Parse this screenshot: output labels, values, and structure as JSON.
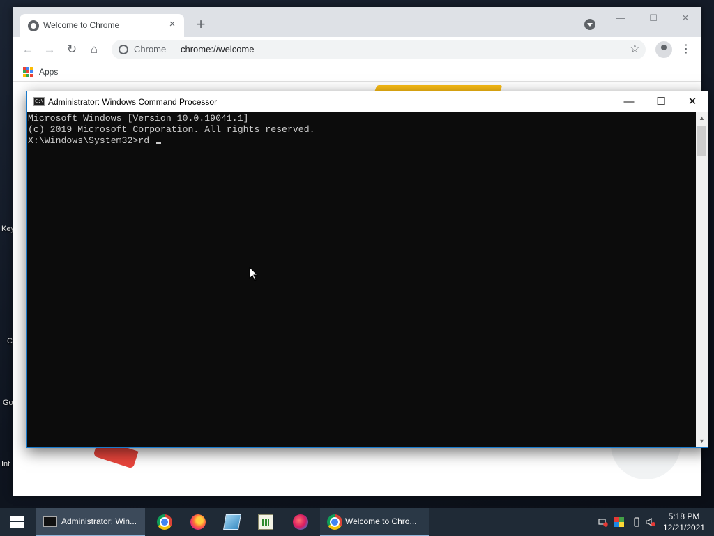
{
  "desktop": {
    "partial_labels": [
      "Key",
      "C",
      "Go",
      "Int"
    ]
  },
  "chrome": {
    "tab_title": "Welcome to Chrome",
    "tab_close": "×",
    "new_tab": "+",
    "window_controls": {
      "minimize": "—",
      "maximize": "☐",
      "close": "✕"
    },
    "nav": {
      "back": "←",
      "forward": "→",
      "reload": "↻",
      "home": "⌂"
    },
    "omnibox": {
      "chip": "Chrome",
      "url": "chrome://welcome"
    },
    "bookmark_star": "☆",
    "menu": "⋮",
    "bookmarks_bar": {
      "apps_label": "Apps"
    },
    "apps_grid_colors": [
      "#ea4335",
      "#4285f4",
      "#fbbc05",
      "#34a853",
      "#ea4335",
      "#4285f4",
      "#fbbc05",
      "#34a853",
      "#ea4335"
    ]
  },
  "cmd": {
    "title": "Administrator: Windows Command Processor",
    "controls": {
      "minimize": "—",
      "maximize": "☐",
      "close": "✕"
    },
    "lines": [
      "Microsoft Windows [Version 10.0.19041.1]",
      "(c) 2019 Microsoft Corporation. All rights reserved.",
      "",
      "X:\\Windows\\System32>rd "
    ],
    "scroll_up": "▲",
    "scroll_down": "▼"
  },
  "taskbar": {
    "start_icon": "windows-logo",
    "items": [
      {
        "label": "Administrator: Win...",
        "icon": "cmd-icon",
        "state": "active"
      },
      {
        "icon": "chrome-icon"
      },
      {
        "icon": "firefox-icon"
      },
      {
        "icon": "notes-icon"
      },
      {
        "icon": "spreadsheet-icon"
      },
      {
        "icon": "paint-icon"
      },
      {
        "label": "Welcome to Chro...",
        "icon": "chrome-icon",
        "state": "running"
      }
    ],
    "clock": {
      "time": "5:18 PM",
      "date": "12/21/2021"
    }
  }
}
